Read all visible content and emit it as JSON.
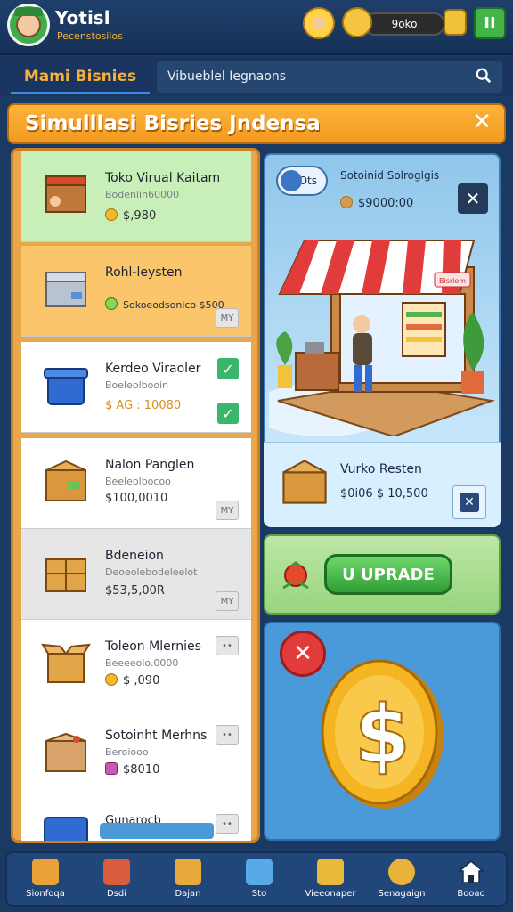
{
  "header": {
    "player_name": "Yotisl",
    "player_subtitle": "Pecenstosilos",
    "balance": "9oko",
    "pause_label": "II"
  },
  "nav": {
    "tab_label": "Mami Bisnies",
    "search_text": "Vibueblel Iegnaons"
  },
  "banner": {
    "title": "Simulllasi Bisries Jndensa",
    "close_label": "✕"
  },
  "businesses": [
    {
      "name": "Toko Virual Kaitam",
      "desc": "Bodenlin60000",
      "price": "$,980",
      "badge": "",
      "icon": "crate-icon",
      "bg": "#c8efb8"
    },
    {
      "name": "Rohl-leysten",
      "desc": "",
      "price": "Sokoeodsonico $500",
      "badge": "",
      "icon": "box-icon",
      "bg": "#fbc56c"
    },
    {
      "name": "Kerdeo Viraoler",
      "desc": "Boeleolbooin",
      "price": "$ AG : 10080",
      "badge": "",
      "icon": "bin-icon",
      "bg": "#ffffff"
    },
    {
      "name": "Nalon Panglen",
      "desc": "Beeleolbocoo",
      "price": "$100,0010",
      "badge": "MY",
      "icon": "cardboard-box-icon",
      "bg": "#ffffff"
    },
    {
      "name": "Bdeneion",
      "desc": "Deoeolebodeleelot",
      "price": "$53,5,00R",
      "badge": "MY",
      "icon": "package-icon",
      "bg": "#e6e6e6"
    },
    {
      "name": "Toleon Mlernies",
      "desc": "Beeeeolo.0000",
      "price": "$ ,090",
      "badge": "••",
      "icon": "open-box-icon",
      "bg": "#ffffff"
    },
    {
      "name": "Sotoinht Merhns",
      "desc": "Beroiooo",
      "price": "$8010",
      "badge": "••",
      "icon": "parcel-icon",
      "bg": "#ffffff"
    },
    {
      "name": "Gunarocb",
      "desc": "",
      "price": "",
      "badge": "••",
      "icon": "container-icon",
      "bg": "#ffffff"
    }
  ],
  "detail": {
    "toggle_label": "Ots",
    "title": "Sotoinid Solroglgis",
    "price": "$9000:00",
    "shop_sign": "Bisrlom",
    "shop_name": "Vurko Resten",
    "shop_price": "$0i06 $ 10,500"
  },
  "upgrade": {
    "label": "U UPRADE"
  },
  "bottom_nav": [
    {
      "label": "Sionfoqa",
      "icon": "warehouse-icon",
      "color": "#e9a13a"
    },
    {
      "label": "Dsdi",
      "icon": "chart-icon",
      "color": "#d95c3c"
    },
    {
      "label": "Dajan",
      "icon": "tag-icon",
      "color": "#e7a93b"
    },
    {
      "label": "Sto",
      "icon": "cube-icon",
      "color": "#58a9e8"
    },
    {
      "label": "Vieeonaper",
      "icon": "spreadsheet-icon",
      "color": "#e8b93a"
    },
    {
      "label": "Senagaign",
      "icon": "gear-icon",
      "color": "#e9b23a"
    },
    {
      "label": "Booao",
      "icon": "home-icon",
      "color": "#ffffff"
    }
  ],
  "colors": {
    "accent_orange": "#f39a1f",
    "brand_navy": "#1b3a63",
    "upgrade_green": "#2f9e36",
    "coin_gold": "#f5b523"
  }
}
